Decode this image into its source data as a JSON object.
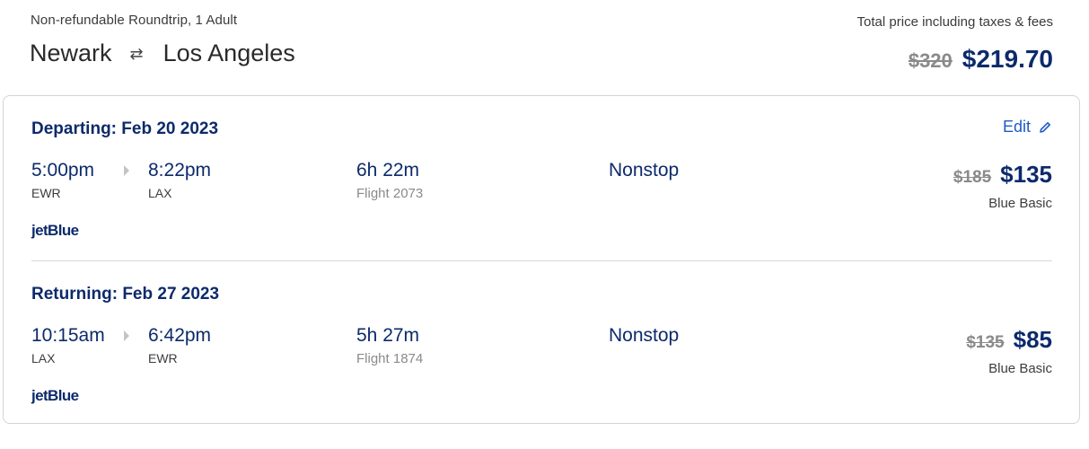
{
  "header": {
    "trip_type": "Non-refundable Roundtrip, 1 Adult",
    "origin": "Newark",
    "swap_symbol": "⇄",
    "destination": "Los Angeles",
    "total_label": "Total price including taxes & fees",
    "total_old_price": "$320",
    "total_new_price": "$219.70"
  },
  "edit_label": "Edit",
  "segments": [
    {
      "title": "Departing: Feb 20 2023",
      "depart_time": "5:00pm",
      "depart_code": "EWR",
      "arrive_time": "8:22pm",
      "arrive_code": "LAX",
      "duration": "6h 22m",
      "flight": "Flight 2073",
      "stops": "Nonstop",
      "old_price": "$185",
      "new_price": "$135",
      "fare": "Blue Basic",
      "airline": "jetBlue"
    },
    {
      "title": "Returning: Feb 27 2023",
      "depart_time": "10:15am",
      "depart_code": "LAX",
      "arrive_time": "6:42pm",
      "arrive_code": "EWR",
      "duration": "5h 27m",
      "flight": "Flight 1874",
      "stops": "Nonstop",
      "old_price": "$135",
      "new_price": "$85",
      "fare": "Blue Basic",
      "airline": "jetBlue"
    }
  ],
  "colors": {
    "brand_navy": "#0c2a6b",
    "link_blue": "#1e5bc6",
    "strike_gray": "#8a8a8a"
  }
}
